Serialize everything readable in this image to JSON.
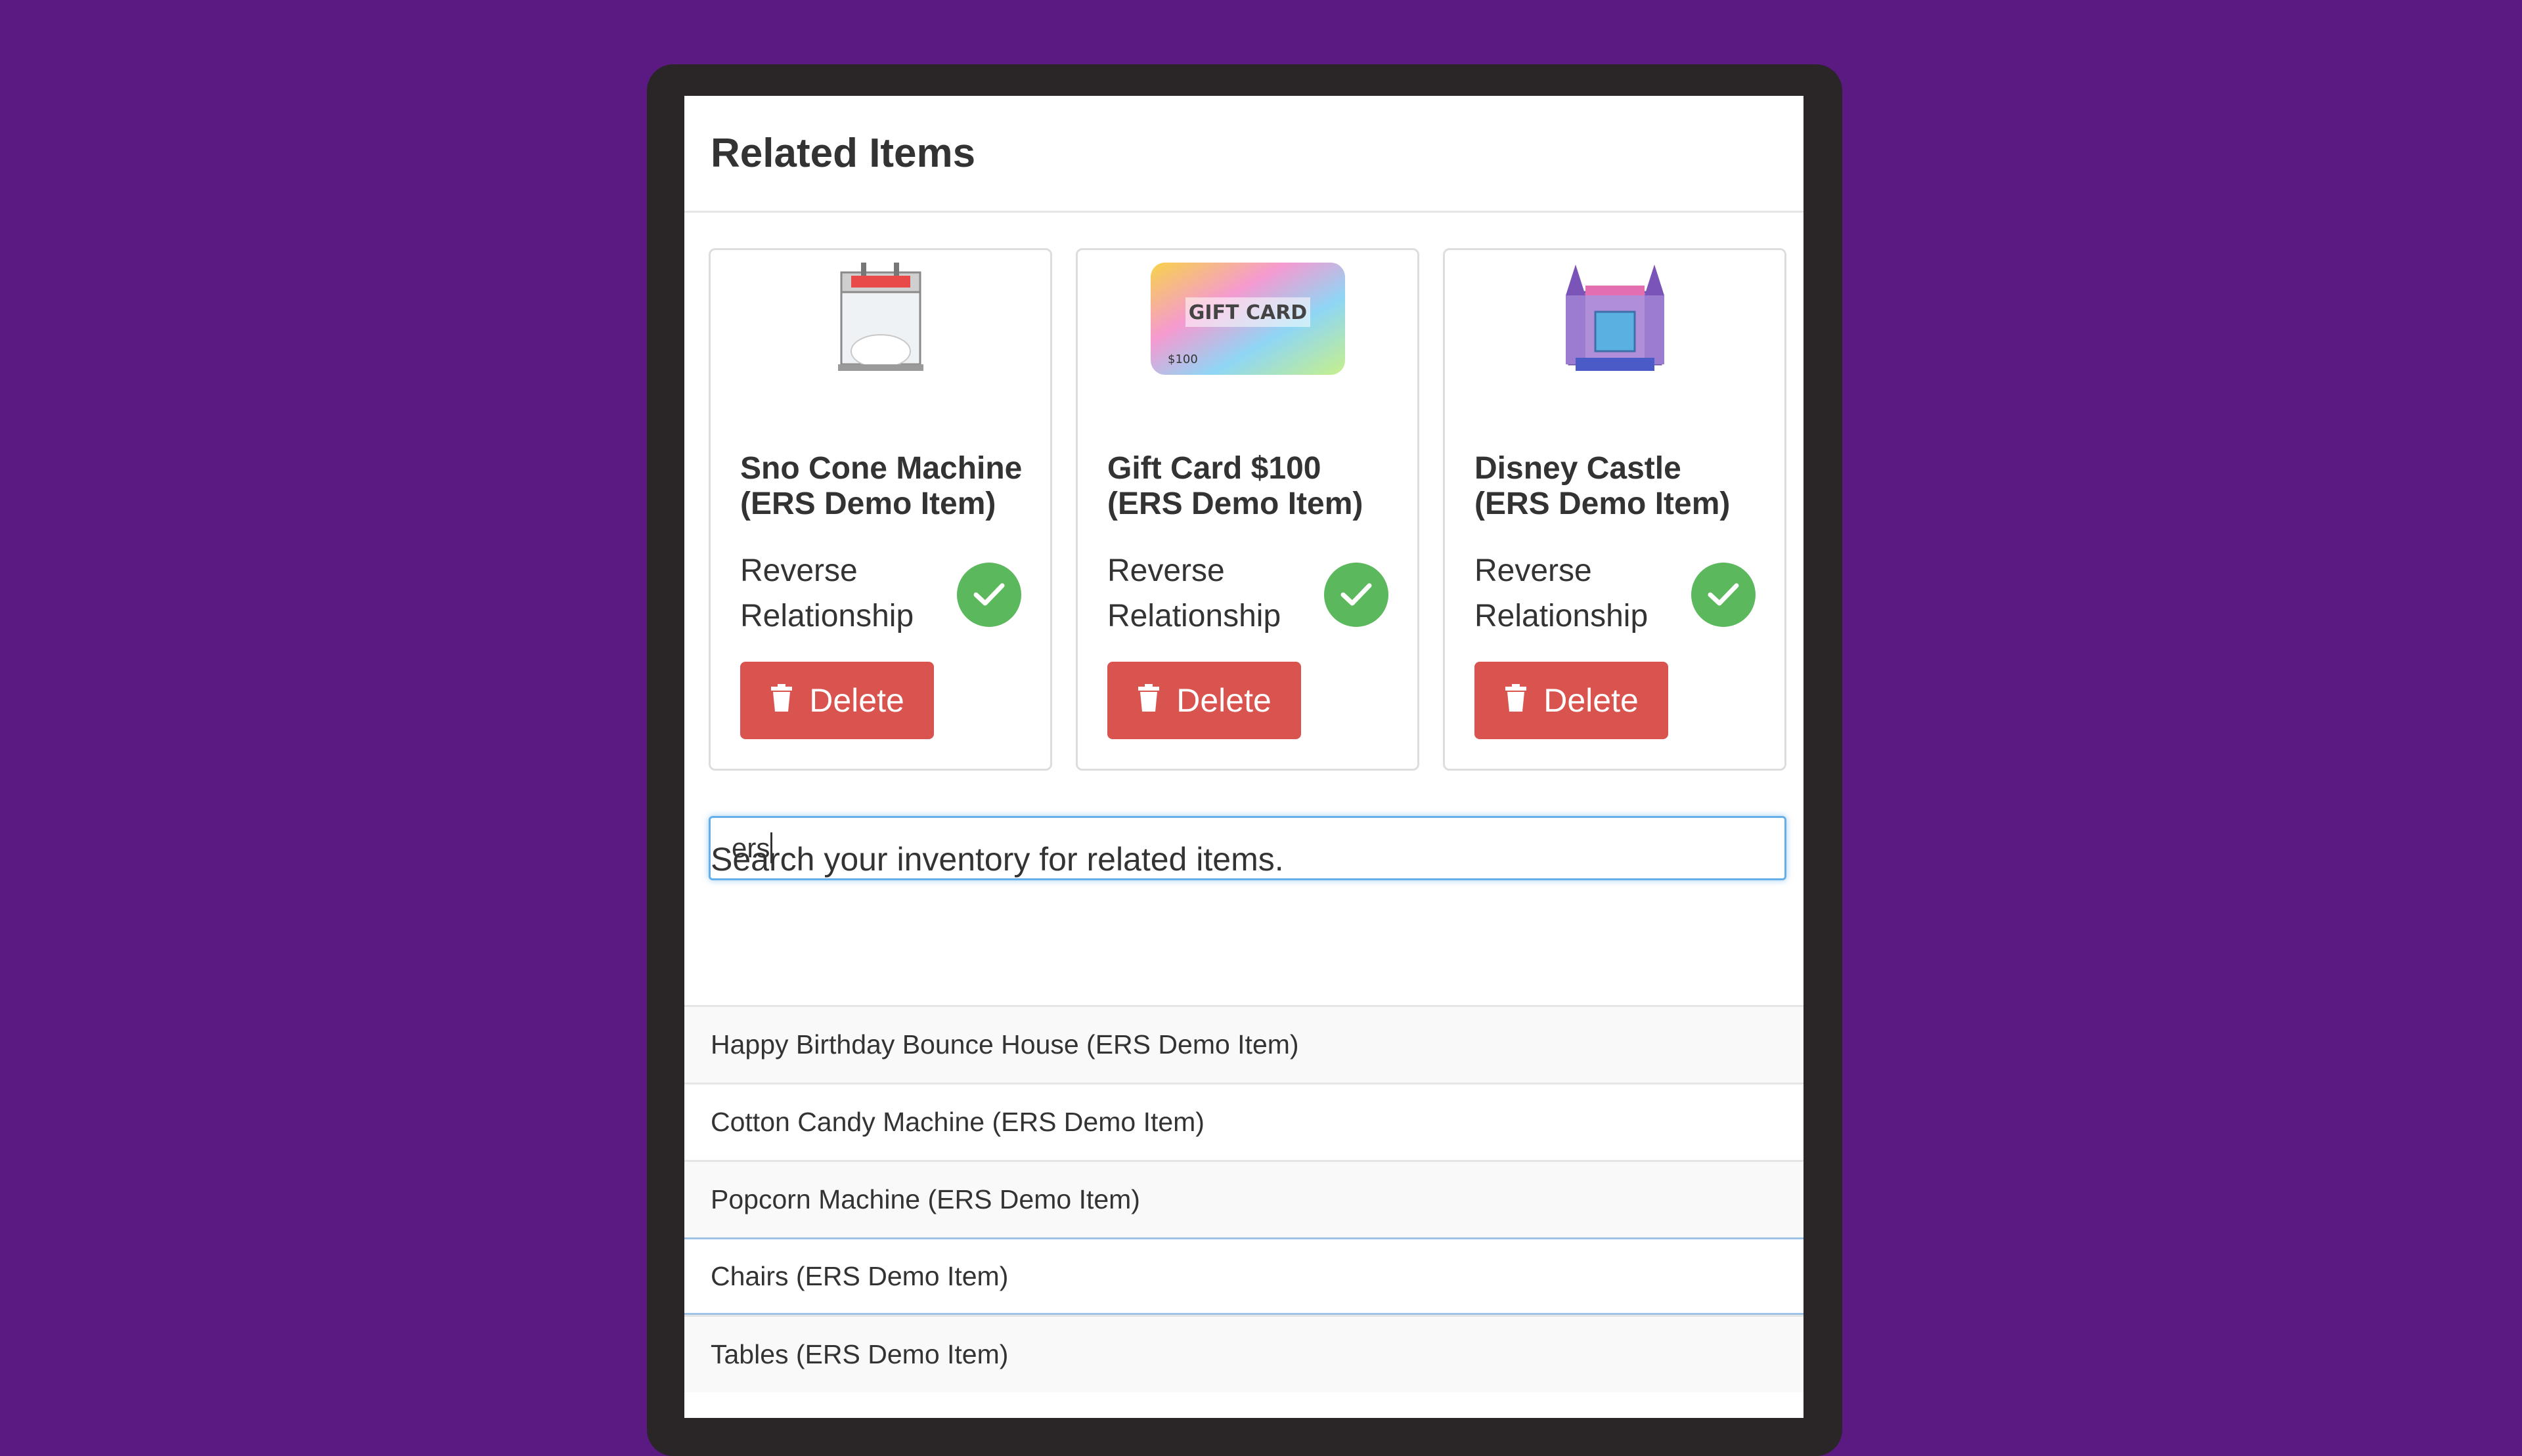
{
  "page": {
    "background_color": "#5a1a82"
  },
  "panel": {
    "title": "Related Items"
  },
  "related_items": [
    {
      "name": "Sno Cone Machine (ERS Demo Item)",
      "relationship_label": "Reverse Relationship",
      "relationship_checked": true,
      "delete_label": "Delete",
      "image": "sno-cone-machine-image"
    },
    {
      "name": "Gift Card $100 (ERS Demo Item)",
      "relationship_label": "Reverse Relationship",
      "relationship_checked": true,
      "delete_label": "Delete",
      "image": "gift-card-image",
      "image_text": "GIFT CARD",
      "image_price": "$100"
    },
    {
      "name": "Disney Castle (ERS Demo Item)",
      "relationship_label": "Reverse Relationship",
      "relationship_checked": true,
      "delete_label": "Delete",
      "image": "bounce-castle-image"
    }
  ],
  "search": {
    "label": "Search your inventory for related items.",
    "value": "ers"
  },
  "results": [
    "Happy Birthday Bounce House (ERS Demo Item)",
    "Cotton Candy Machine (ERS Demo Item)",
    "Popcorn Machine (ERS Demo Item)",
    "Chairs (ERS Demo Item)",
    "Tables (ERS Demo Item)"
  ],
  "colors": {
    "delete": "#d9534f",
    "check": "#5cb85c",
    "focus": "#66afe9"
  }
}
